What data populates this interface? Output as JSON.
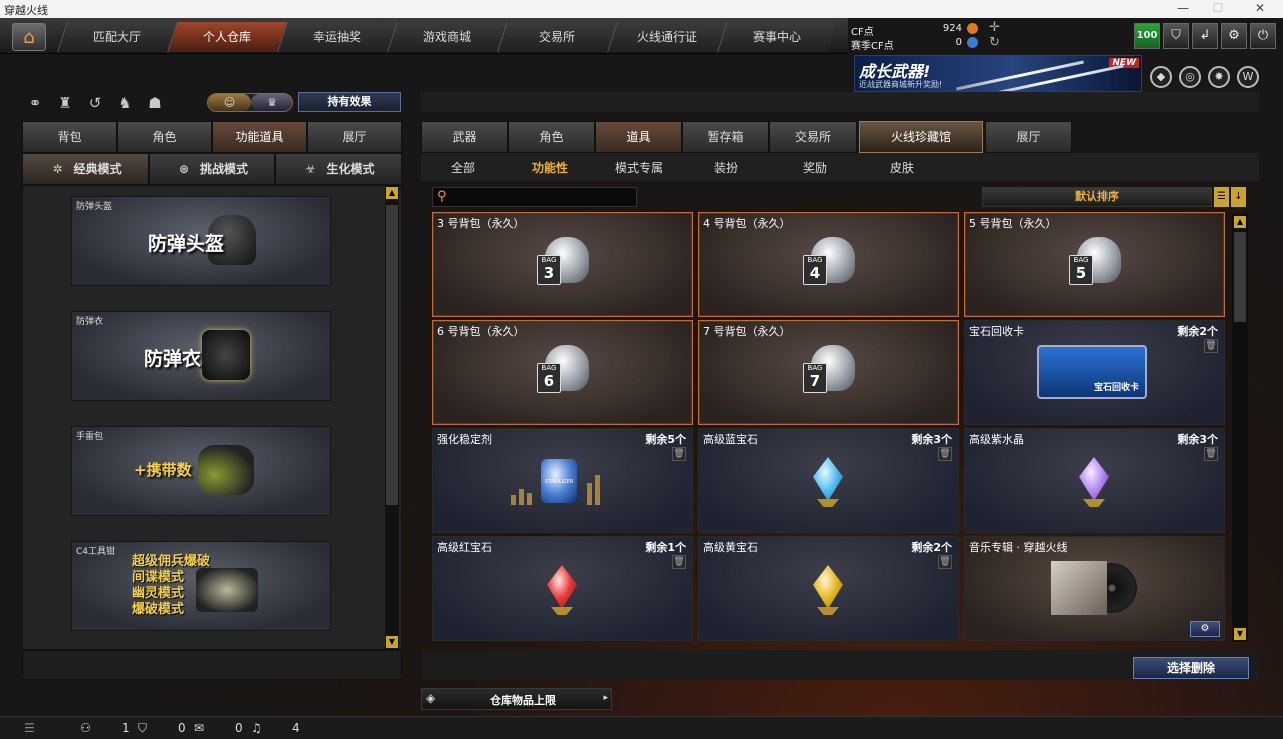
{
  "window": {
    "title": "穿越火线",
    "controls": [
      "—",
      "☐",
      "✕"
    ]
  },
  "nav": {
    "tabs": [
      {
        "label": "匹配大厅",
        "active": false
      },
      {
        "label": "个人仓库",
        "active": true
      },
      {
        "label": "幸运抽奖",
        "active": false
      },
      {
        "label": "游戏商城",
        "active": false
      },
      {
        "label": "交易所",
        "active": false
      },
      {
        "label": "火线通行证",
        "active": false
      },
      {
        "label": "赛事中心",
        "active": false
      }
    ]
  },
  "currency": {
    "cf_label": "CF点",
    "cf_value": "924",
    "season_label": "赛季CF点",
    "season_value": "0"
  },
  "top_buttons": {
    "level": "100"
  },
  "banner": {
    "title": "成长武器!",
    "subtitle": "近战武器商城新升奖励!",
    "badge": "NEW"
  },
  "left": {
    "effect_button": "持有效果",
    "tabs": [
      "背包",
      "角色",
      "功能道具",
      "展厅"
    ],
    "active_tab": 2,
    "modes": [
      {
        "label": "经典模式",
        "icon": "star-icon"
      },
      {
        "label": "挑战模式",
        "icon": "dial-icon"
      },
      {
        "label": "生化模式",
        "icon": "biohazard-icon"
      }
    ],
    "equipment": [
      {
        "label": "防弹头盔",
        "big": "防弹头盔"
      },
      {
        "label": "防弹衣",
        "big": "防弹衣"
      },
      {
        "label": "手雷包",
        "big": "+携带数"
      },
      {
        "label": "C4工具钳",
        "lines": [
          "超级佣兵爆破",
          "间谍模式",
          "幽灵模式",
          "爆破模式"
        ]
      }
    ]
  },
  "right": {
    "tabs": [
      "武器",
      "角色",
      "道具",
      "暂存箱",
      "交易所",
      "火线珍藏馆",
      "展厅"
    ],
    "active_tab": 2,
    "subtabs": [
      "全部",
      "功能性",
      "模式专属",
      "装扮",
      "奖励",
      "皮肤"
    ],
    "active_subtab": 1,
    "search": {
      "value": "",
      "placeholder": ""
    },
    "sort": "默认排序",
    "items": [
      {
        "name": "3 号背包（永久）",
        "type": "bag",
        "num": "3"
      },
      {
        "name": "4 号背包（永久）",
        "type": "bag",
        "num": "4"
      },
      {
        "name": "5 号背包（永久）",
        "type": "bag",
        "num": "5"
      },
      {
        "name": "6 号背包（永久）",
        "type": "bag",
        "num": "6"
      },
      {
        "name": "7 号背包（永久）",
        "type": "bag",
        "num": "7"
      },
      {
        "name": "宝石回收卡",
        "type": "gemcard",
        "qty": "剩余2个",
        "card_text": "宝石回收卡"
      },
      {
        "name": "强化稳定剂",
        "type": "stabilizer",
        "qty": "剩余5个",
        "jar_text": "STABILIZER"
      },
      {
        "name": "高级蓝宝石",
        "type": "gem",
        "qty": "剩余3个",
        "color": "#54c0f0"
      },
      {
        "name": "高级紫水晶",
        "type": "gem",
        "qty": "剩余3个",
        "color": "#b58cf0"
      },
      {
        "name": "高级红宝石",
        "type": "gem",
        "qty": "剩余1个",
        "color": "#e83838"
      },
      {
        "name": "高级黄宝石",
        "type": "gem",
        "qty": "剩余2个",
        "color": "#e8b820"
      },
      {
        "name": "音乐专辑 · 穿越火线",
        "type": "music"
      }
    ],
    "delete_button": "选择删除",
    "limit_label": "仓库物品上限"
  },
  "status": {
    "friends": "1",
    "clan": "0",
    "messages": "0",
    "volume": "4"
  }
}
